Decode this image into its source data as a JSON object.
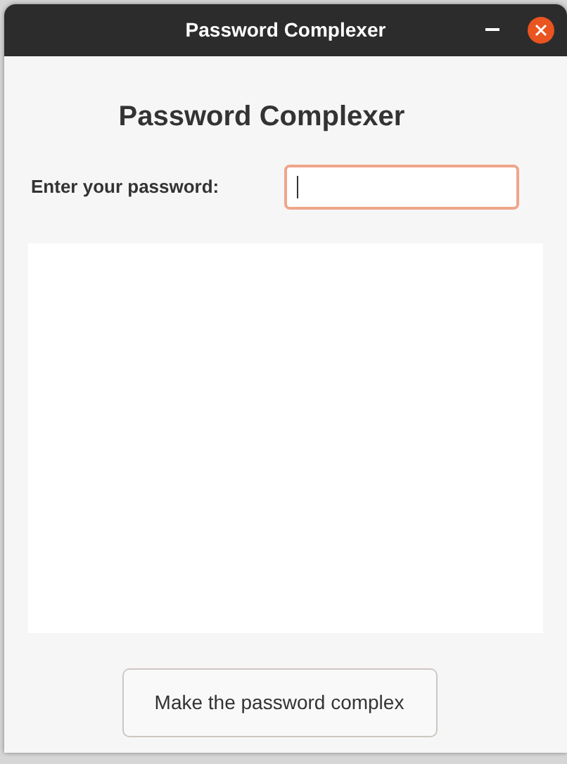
{
  "window": {
    "title": "Password Complexer"
  },
  "heading": "Password Complexer",
  "password": {
    "label": "Enter your password:",
    "focused": true
  },
  "button": {
    "label": "Make the password complex"
  }
}
